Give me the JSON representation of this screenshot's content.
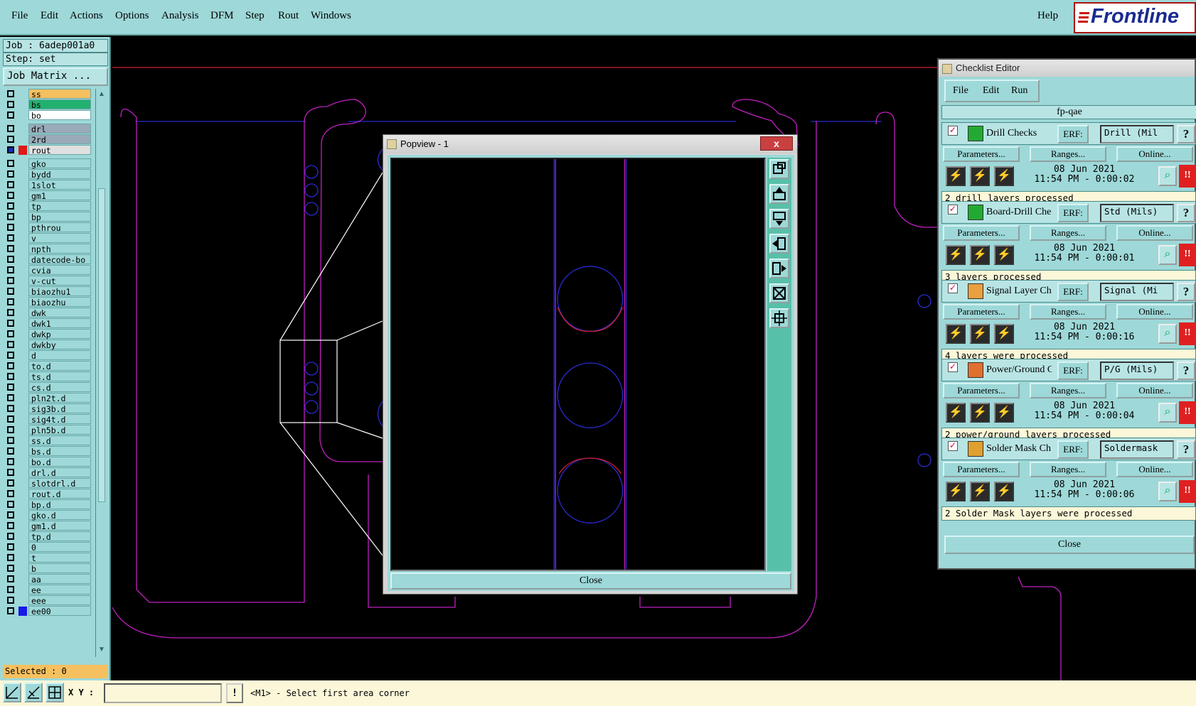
{
  "menubar": {
    "items": [
      "File",
      "Edit",
      "Actions",
      "Options",
      "Analysis",
      "DFM",
      "Step",
      "Rout",
      "Windows"
    ],
    "help": "Help",
    "logo": "Frontline"
  },
  "left_panel": {
    "job": "Job : 6adep001a0",
    "step": "Step: set",
    "job_matrix": "Job Matrix ...",
    "selected": "Selected : 0",
    "layers": [
      {
        "name": "ss",
        "color": "#f5c060"
      },
      {
        "name": "bs",
        "color": "#22b070"
      },
      {
        "name": "bo",
        "color": "#ffffff"
      },
      {
        "name": "drl",
        "color": "#9aaab8"
      },
      {
        "name": "2rd",
        "color": "#9aaab8"
      },
      {
        "name": "rout",
        "color": "#e0e0e0"
      },
      {
        "name": "gko",
        "color": "#9ed8d8"
      },
      {
        "name": "bydd",
        "color": "#9ed8d8"
      },
      {
        "name": "1slot",
        "color": "#9ed8d8"
      },
      {
        "name": "gm1",
        "color": "#9ed8d8"
      },
      {
        "name": "tp",
        "color": "#9ed8d8"
      },
      {
        "name": "bp",
        "color": "#9ed8d8"
      },
      {
        "name": "pthrou",
        "color": "#9ed8d8"
      },
      {
        "name": "v",
        "color": "#9ed8d8"
      },
      {
        "name": "npth",
        "color": "#9ed8d8"
      },
      {
        "name": "datecode-bo",
        "color": "#9ed8d8"
      },
      {
        "name": "cvia",
        "color": "#9ed8d8"
      },
      {
        "name": "v-cut",
        "color": "#9ed8d8"
      },
      {
        "name": "biaozhu1",
        "color": "#9ed8d8"
      },
      {
        "name": "biaozhu",
        "color": "#9ed8d8"
      },
      {
        "name": "dwk",
        "color": "#9ed8d8"
      },
      {
        "name": "dwk1",
        "color": "#9ed8d8"
      },
      {
        "name": "dwkp",
        "color": "#9ed8d8"
      },
      {
        "name": "dwkby",
        "color": "#9ed8d8"
      },
      {
        "name": "d",
        "color": "#9ed8d8"
      },
      {
        "name": "to.d",
        "color": "#9ed8d8"
      },
      {
        "name": "ts.d",
        "color": "#9ed8d8"
      },
      {
        "name": "cs.d",
        "color": "#9ed8d8"
      },
      {
        "name": "pln2t.d",
        "color": "#9ed8d8"
      },
      {
        "name": "sig3b.d",
        "color": "#9ed8d8"
      },
      {
        "name": "sig4t.d",
        "color": "#9ed8d8"
      },
      {
        "name": "pln5b.d",
        "color": "#9ed8d8"
      },
      {
        "name": "ss.d",
        "color": "#9ed8d8"
      },
      {
        "name": "bs.d",
        "color": "#9ed8d8"
      },
      {
        "name": "bo.d",
        "color": "#9ed8d8"
      },
      {
        "name": "drl.d",
        "color": "#9ed8d8"
      },
      {
        "name": "slotdrl.d",
        "color": "#9ed8d8"
      },
      {
        "name": "rout.d",
        "color": "#9ed8d8"
      },
      {
        "name": "bp.d",
        "color": "#9ed8d8"
      },
      {
        "name": "gko.d",
        "color": "#9ed8d8"
      },
      {
        "name": "gm1.d",
        "color": "#9ed8d8"
      },
      {
        "name": "tp.d",
        "color": "#9ed8d8"
      },
      {
        "name": "0",
        "color": "#9ed8d8"
      },
      {
        "name": "t",
        "color": "#9ed8d8"
      },
      {
        "name": "b",
        "color": "#9ed8d8"
      },
      {
        "name": "aa",
        "color": "#9ed8d8"
      },
      {
        "name": "ee",
        "color": "#9ed8d8"
      },
      {
        "name": "eee",
        "color": "#9ed8d8"
      },
      {
        "name": "ee00",
        "color": "#9ed8d8"
      }
    ]
  },
  "bottom": {
    "xy_label": "X Y :",
    "xy_value": "",
    "prompt_btn": "!",
    "prompt": "<M1> - Select first area corner"
  },
  "popview": {
    "title": "Popview - 1",
    "close_x": "x",
    "close_button": "Close"
  },
  "checklist": {
    "title": "Checklist Editor",
    "menu": [
      "File",
      "Edit",
      "Run"
    ],
    "name": "fp-qae",
    "erf_label": "ERF:",
    "help": "?",
    "parameters": "Parameters...",
    "ranges": "Ranges...",
    "online": "Online...",
    "alert": "!!",
    "close": "Close",
    "checks": [
      {
        "name": "Drill Checks",
        "erf": "Drill (Mil",
        "date": "08 Jun 2021",
        "time": "11:54 PM - 0:00:02",
        "status": "2 drill layers processed",
        "icon_color": "#22aa33"
      },
      {
        "name": "Board-Drill Che",
        "erf": "Std (Mils)",
        "date": "08 Jun 2021",
        "time": "11:54 PM - 0:00:01",
        "status": "3 layers processed",
        "icon_color": "#22aa33"
      },
      {
        "name": "Signal Layer Ch",
        "erf": "Signal (Mi",
        "date": "08 Jun 2021",
        "time": "11:54 PM - 0:00:16",
        "status": "4 layers were processed",
        "icon_color": "#e8a040"
      },
      {
        "name": "Power/Ground C",
        "erf": "P/G (Mils)",
        "date": "08 Jun 2021",
        "time": "11:54 PM - 0:00:04",
        "status": "2 power/ground layers processed",
        "icon_color": "#e07030"
      },
      {
        "name": "Solder Mask Ch",
        "erf": "Soldermask",
        "date": "08 Jun 2021",
        "time": "11:54 PM - 0:00:06",
        "status": "2 Solder Mask layers were processed",
        "icon_color": "#e0a030"
      }
    ]
  }
}
